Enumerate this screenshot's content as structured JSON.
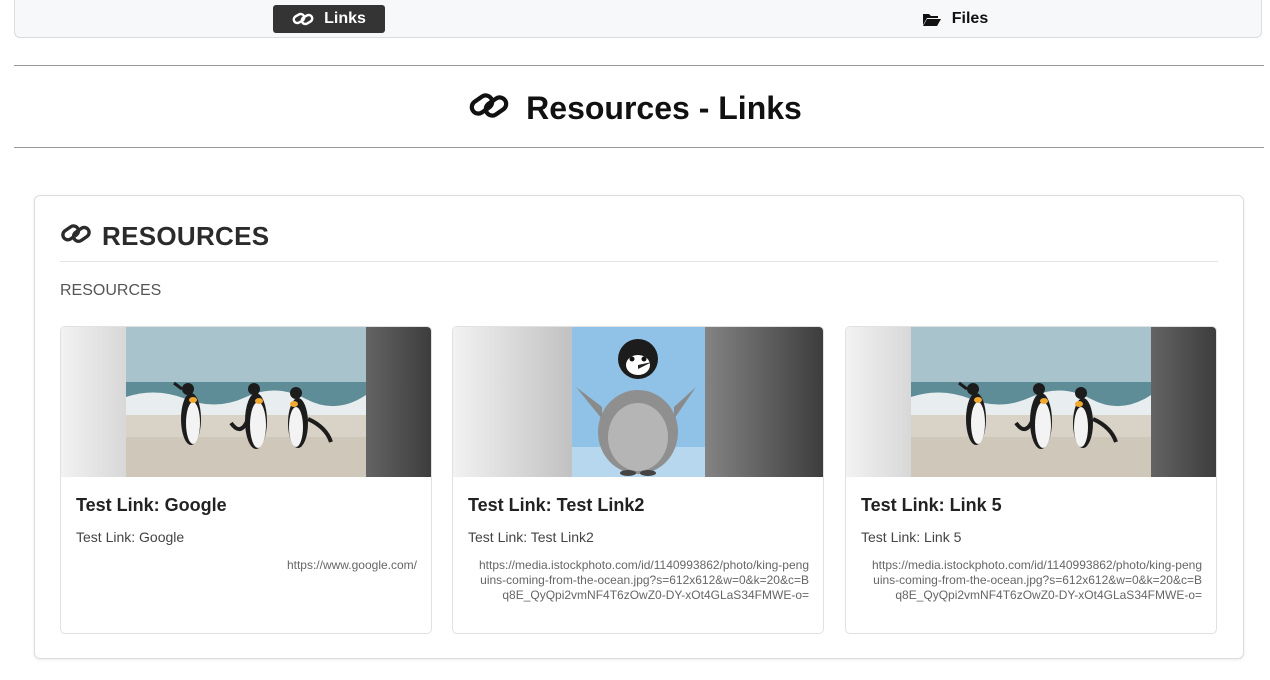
{
  "tabs": [
    {
      "label": "Links",
      "icon": "link-icon",
      "active": true
    },
    {
      "label": "Files",
      "icon": "folder-open-icon",
      "active": false
    }
  ],
  "page": {
    "title": "Resources - Links",
    "icon": "link-icon"
  },
  "panel": {
    "heading": "RESOURCES",
    "subheading": "RESOURCES",
    "cards": [
      {
        "title": "Test Link: Google",
        "description": "Test Link: Google",
        "url": "https://www.google.com/",
        "image": "king-penguins-image"
      },
      {
        "title": "Test Link: Test Link2",
        "description": "Test Link: Test Link2",
        "url": "https://media.istockphoto.com/id/1140993862/photo/king-penguins-coming-from-the-ocean.jpg?s=612x612&w=0&k=20&c=Bq8E_QyQpi2vmNF4T6zOwZ0-DY-xOt4GLaS34FMWE-o=",
        "image": "penguin-chick-image"
      },
      {
        "title": "Test Link: Link 5",
        "description": "Test Link: Link 5",
        "url": "https://media.istockphoto.com/id/1140993862/photo/king-penguins-coming-from-the-ocean.jpg?s=612x612&w=0&k=20&c=Bq8E_QyQpi2vmNF4T6zOwZ0-DY-xOt4GLaS34FMWE-o=",
        "image": "king-penguins-image"
      }
    ]
  },
  "colors": {
    "active_tab": "#343434",
    "border": "#dddddd",
    "text": "#222222"
  }
}
